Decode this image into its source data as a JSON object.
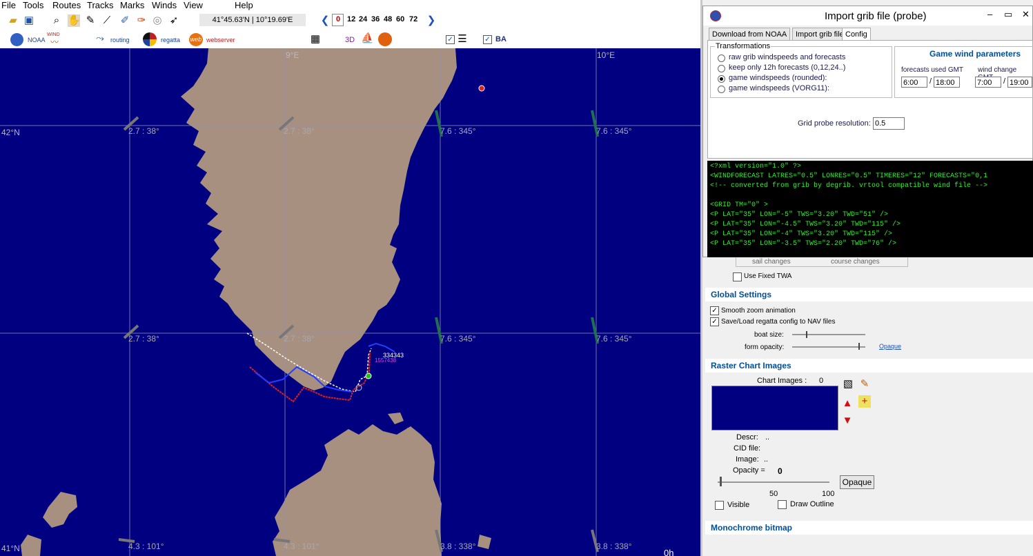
{
  "menu": [
    "File",
    "Tools",
    "Routes",
    "Tracks",
    "Marks",
    "Winds",
    "View",
    "Help"
  ],
  "toolbar": {
    "coords": "41°45.63'N | 10°19.69'E",
    "time_steps": [
      "0",
      "12",
      "24",
      "36",
      "48",
      "60",
      "72"
    ],
    "noaa_label": "NOAA",
    "wind_label": "WIND",
    "routing_label": "routing",
    "regatta_label": "regatta",
    "web_label": "web",
    "webserver_label": "webserver",
    "threed_label": "3D",
    "ba_label": "BA"
  },
  "map": {
    "lon_labels": [
      "9°E",
      "10°E"
    ],
    "lat_labels": [
      "42°N",
      "41°N"
    ],
    "wind_labels": [
      "2.7 : 38°",
      "2.7 : 38°",
      "7.6 : 345°",
      "7.6 : 345°",
      "2.7 : 38°",
      "2.7 : 38°",
      "7.6 : 345°",
      "7.6 : 345°",
      "4.3 : 101°",
      "4.3 : 101°",
      "3.8 : 338°",
      "3.8 : 338°"
    ],
    "boat_label": "334343",
    "boat_sub": "1557438",
    "corner_label": "0h"
  },
  "dialog": {
    "title": "Import grib file (probe)",
    "tabs": [
      "Download from NOAA",
      "Import grib file",
      "Config"
    ],
    "transformations_title": "Transformations",
    "options": [
      "raw grib windspeeds and forecasts",
      "keep only 12h forecasts (0,12,24..)",
      "game windspeeds (rounded):",
      "game windspeeds (VORG11):"
    ],
    "game_wind_title": "Game wind parameters",
    "forecasts_label": "forecasts used GMT",
    "wind_change_label": "wind change GMT",
    "f1": "6:00",
    "f2": "18:00",
    "w1": "7:00",
    "w2": "19:00",
    "grid_probe_label": "Grid probe resolution:",
    "grid_probe_value": "0.5",
    "xml_lines": [
      "<?xml version=\"1.0\" ?>",
      "<WINDFORECAST LATRES=\"0.5\" LONRES=\"0.5\" TIMERES=\"12\" FORECASTS=\"0,1",
      "<!-- converted from grib by degrib. vrtool compatible wind file -->",
      "",
      "<GRID TM=\"0\" >",
      "<P LAT=\"35\" LON=\"-5\" TWS=\"3.20\" TWD=\"51\" />",
      "<P LAT=\"35\" LON=\"-4.5\" TWS=\"3.20\" TWD=\"115\" />",
      "<P LAT=\"35\" LON=\"-4\" TWS=\"3.20\" TWD=\"115\" />",
      "<P LAT=\"35\" LON=\"-3.5\" TWS=\"2.20\" TWD=\"76\" />"
    ]
  },
  "settings": {
    "sail_changes": "sail changes",
    "course_changes": "course changes",
    "use_fixed_twa": "Use Fixed TWA",
    "global_title": "Global Settings",
    "smooth_zoom": "Smooth zoom animation",
    "save_load": "Save/Load regatta config to NAV files",
    "boat_size": "boat size:",
    "form_opacity": "form opacity:",
    "opaque_link": "Opaque",
    "raster_title": "Raster Chart Images",
    "chart_images_label": "Chart Images :",
    "chart_images_count": "0",
    "descr_label": "Descr:",
    "descr_value": "..",
    "cid_label": "CID file:",
    "image_label": "Image:",
    "image_value": "..",
    "opacity_label": "Opacity =",
    "opacity_value": "0",
    "scale_50": "50",
    "scale_100": "100",
    "opaque_button": "Opaque",
    "visible_label": "Visible",
    "draw_outline_label": "Draw Outline",
    "mono_title": "Monochrome bitmap"
  },
  "colors": {
    "sea": "#000080",
    "land": "#a89080",
    "xml_text": "#33ee33",
    "section_header": "#0050a0"
  }
}
